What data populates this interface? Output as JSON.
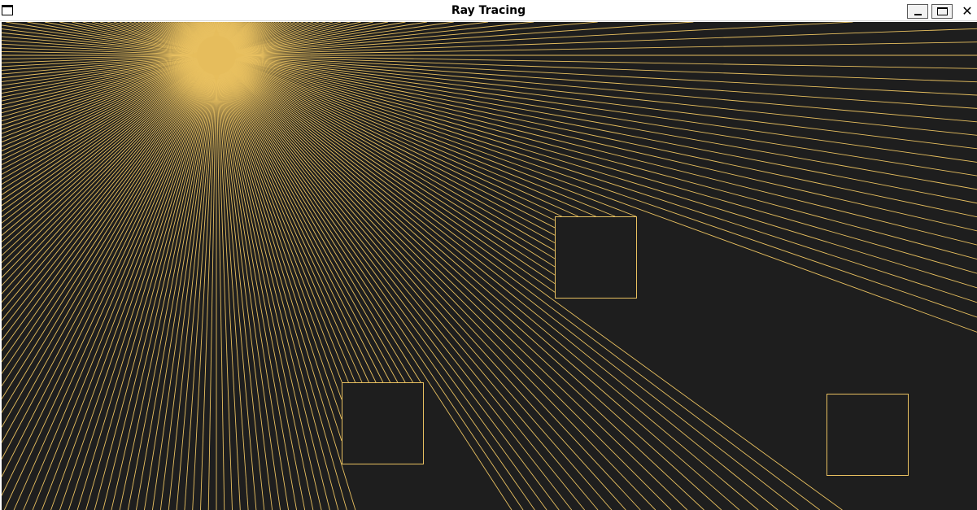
{
  "window": {
    "title": "Ray Tracing",
    "minimize_glyph": "",
    "maximize_glyph": "",
    "close_glyph": "✕"
  },
  "scene": {
    "background_color": "#1e1e1e",
    "ray_color": "#e8c060",
    "source_color": "#e6bd5c",
    "obstacle_color": "#e8c060"
  }
}
